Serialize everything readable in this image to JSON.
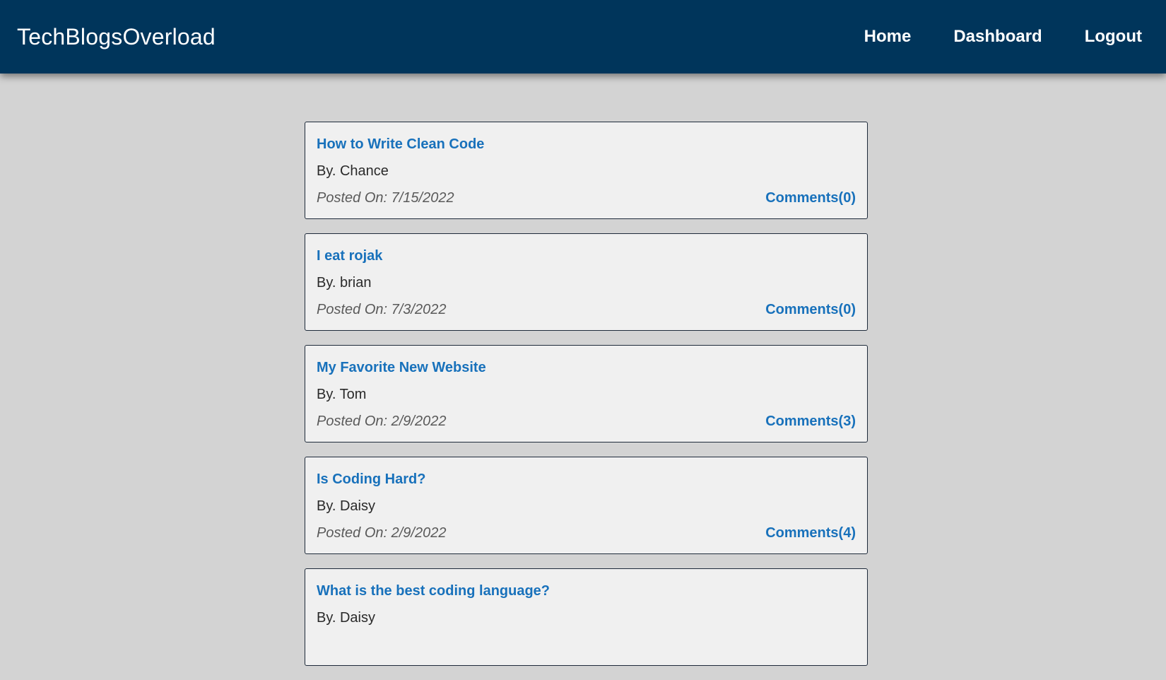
{
  "header": {
    "brand": "TechBlogsOverload",
    "nav": {
      "home": "Home",
      "dashboard": "Dashboard",
      "logout": "Logout"
    }
  },
  "colors": {
    "header_bg": "#00355b",
    "page_bg": "#d3d3d3",
    "card_bg": "#f0f0f0",
    "link": "#1871bb"
  },
  "posts": [
    {
      "title": "How to Write Clean Code",
      "author": "By. Chance",
      "date": "Posted On: 7/15/2022",
      "comments": "Comments(0)"
    },
    {
      "title": "I eat rojak",
      "author": "By. brian",
      "date": "Posted On: 7/3/2022",
      "comments": "Comments(0)"
    },
    {
      "title": "My Favorite New Website",
      "author": "By. Tom",
      "date": "Posted On: 2/9/2022",
      "comments": "Comments(3)"
    },
    {
      "title": "Is Coding Hard?",
      "author": "By. Daisy",
      "date": "Posted On: 2/9/2022",
      "comments": "Comments(4)"
    },
    {
      "title": "What is the best coding language?",
      "author": "By. Daisy",
      "date": "",
      "comments": ""
    }
  ]
}
